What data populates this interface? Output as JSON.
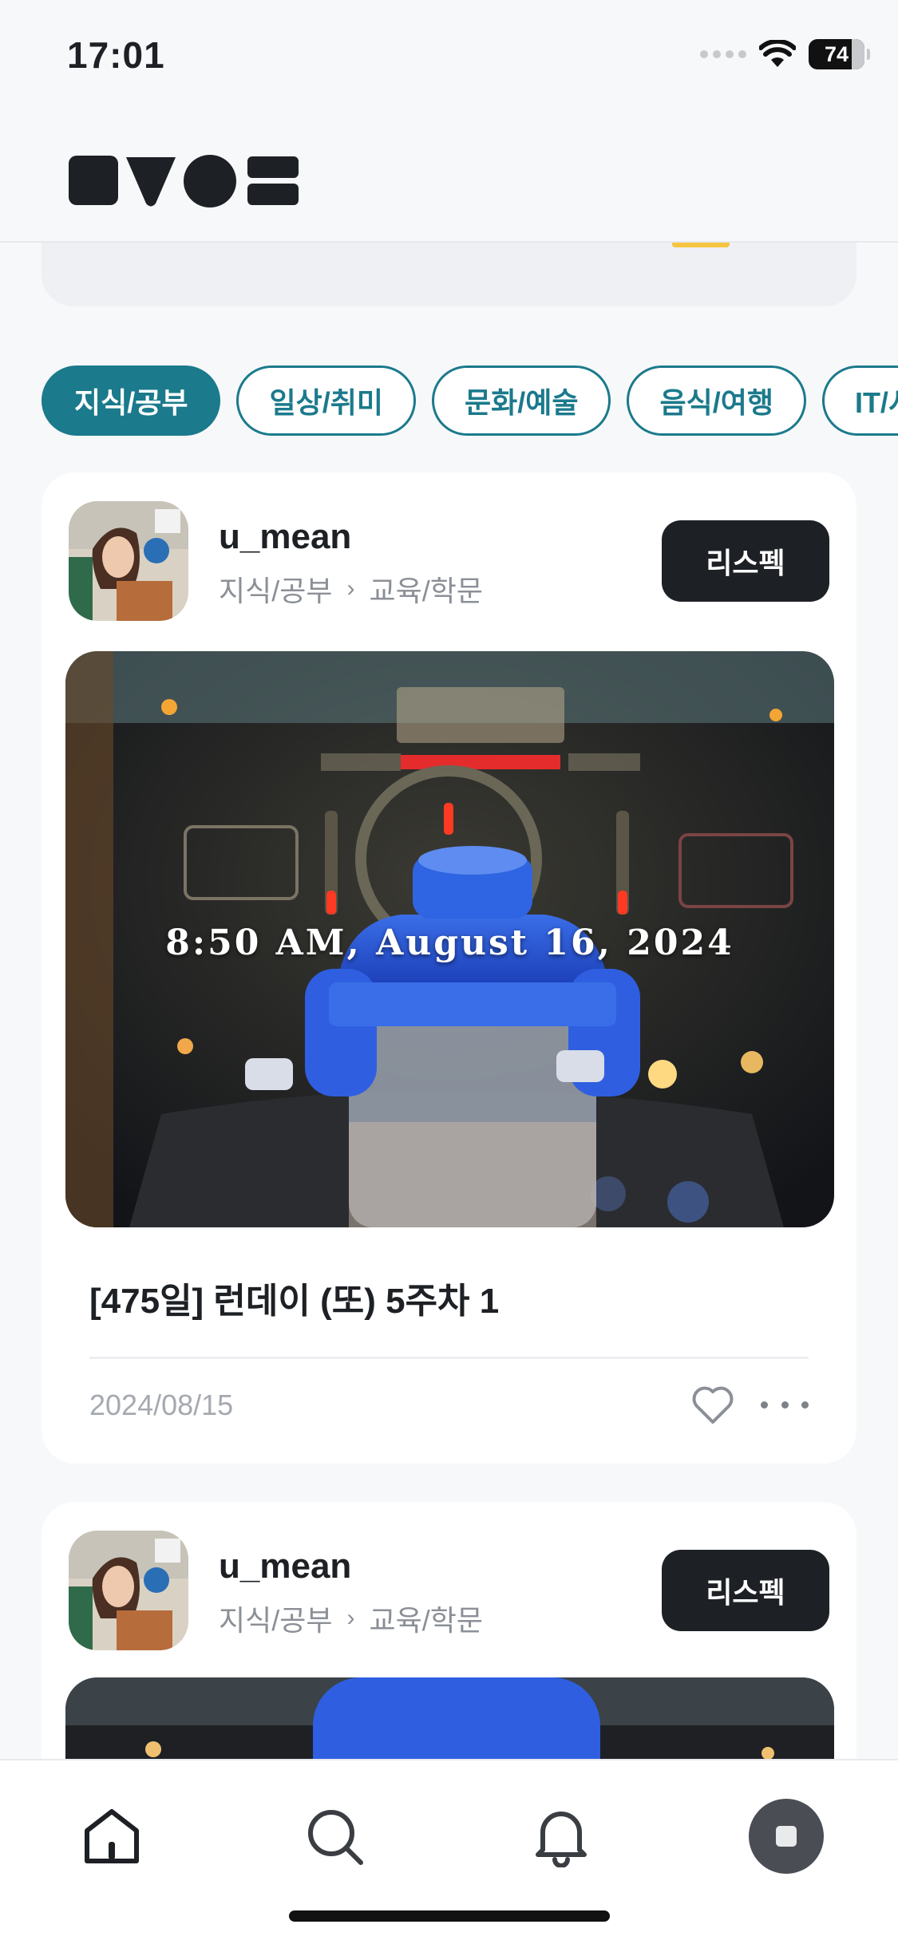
{
  "status_bar": {
    "time": "17:01",
    "battery": "74"
  },
  "header": {
    "logo": "logo"
  },
  "categories": [
    {
      "label": "지식/공부",
      "active": true
    },
    {
      "label": "일상/취미",
      "active": false
    },
    {
      "label": "문화/예술",
      "active": false
    },
    {
      "label": "음식/여행",
      "active": false
    },
    {
      "label": "IT/시",
      "active": false
    }
  ],
  "posts": [
    {
      "username": "u_mean",
      "category": "지식/공부",
      "subcategory": "교육/학문",
      "spec_button": "리스펙",
      "image_stamp": "8:50 AM, August 16, 2024",
      "title": "[475일] 런데이 (또) 5주차 1",
      "date": "2024/08/15"
    },
    {
      "username": "u_mean",
      "category": "지식/공부",
      "subcategory": "교육/학문",
      "spec_button": "리스펙"
    }
  ],
  "tab_bar": {
    "items": [
      "home-icon",
      "search-icon",
      "bell-icon",
      "profile-icon"
    ]
  },
  "colors": {
    "accent": "#1b7a8c",
    "dark": "#1d2024"
  }
}
